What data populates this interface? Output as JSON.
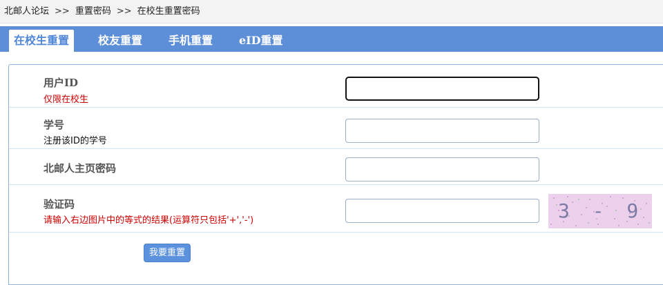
{
  "breadcrumb": {
    "items": [
      "北邮人论坛",
      "重置密码",
      "在校生重置密码"
    ],
    "separator": ">>"
  },
  "tabs": [
    {
      "label": "在校生重置",
      "active": true
    },
    {
      "label": "校友重置",
      "active": false
    },
    {
      "label": "手机重置",
      "active": false
    },
    {
      "label": "eID重置",
      "active": false
    }
  ],
  "form": {
    "userid": {
      "label": "用户ID",
      "hint": "仅限在校生",
      "value": ""
    },
    "student_no": {
      "label": "学号",
      "hint": "注册该ID的学号",
      "value": ""
    },
    "homepage_password": {
      "label": "北邮人主页密码",
      "value": ""
    },
    "captcha": {
      "label": "验证码",
      "hint": "请输入右边图片中的等式的结果(运算符只包括'+','-')",
      "value": "",
      "image_text": "3 - 9 ="
    },
    "submit_label": "我要重置"
  },
  "colors": {
    "tabbar": "#5d8fd9",
    "button": "#5b91dd",
    "hint_red": "#cc0000",
    "captcha_bg": "#ecd0ec"
  }
}
